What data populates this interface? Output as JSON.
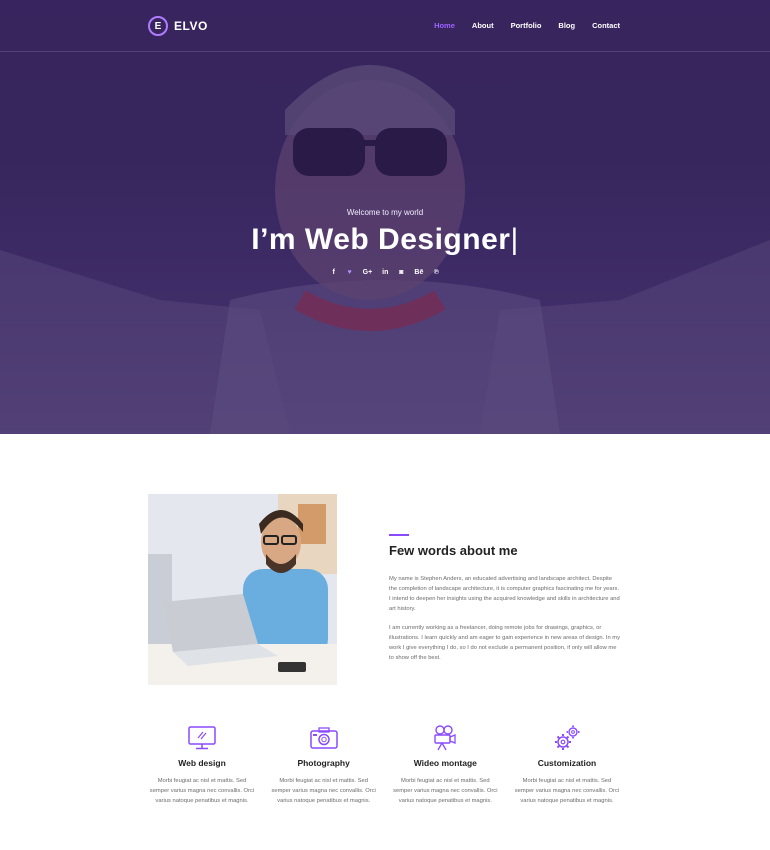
{
  "brand": {
    "logo_letter": "E",
    "name": "ELVO"
  },
  "nav": {
    "items": [
      {
        "label": "Home",
        "active": true
      },
      {
        "label": "About"
      },
      {
        "label": "Portfolio"
      },
      {
        "label": "Blog"
      },
      {
        "label": "Contact"
      }
    ]
  },
  "hero": {
    "welcome": "Welcome to my world",
    "headline": "I’m Web Designer",
    "cursor": "|",
    "socials": [
      {
        "glyph": "f",
        "icon": "facebook-icon"
      },
      {
        "glyph": "♥",
        "icon": "twitter-icon"
      },
      {
        "glyph": "G+",
        "icon": "google-plus-icon"
      },
      {
        "glyph": "in",
        "icon": "linkedin-icon"
      },
      {
        "glyph": "◙",
        "icon": "instagram-icon"
      },
      {
        "glyph": "Bē",
        "icon": "behance-icon"
      },
      {
        "glyph": "℗",
        "icon": "pinterest-icon"
      }
    ]
  },
  "about": {
    "title": "Few words about me",
    "paragraphs": [
      "My name is Stephen Anders, an educated advertising and landscape architect. Despite the completion of landscape architecture, it is computer graphics fascinating me for years. I intend to deepen her insights using the acquired knowledge and skills in architecture and art history.",
      "I am currently working as a freelancer, doing remote jobs for drawings, graphics, or illustrations. I learn quickly and am eager to gain experience in new areas of design. In my work I give everything I do, so I do not exclude a permanent position, if only will allow me to show off the best."
    ]
  },
  "services": [
    {
      "title": "Web design",
      "icon": "monitor-icon",
      "desc": "Morbi feugiat ac nisl et mattis. Sed semper varius magna nec convallis. Orci varius natoque penatibus et magnis."
    },
    {
      "title": "Photography",
      "icon": "camera-icon",
      "desc": "Morbi feugiat ac nisl et mattis. Sed semper varius magna nec convallis. Orci varius natoque penatibus et magnis."
    },
    {
      "title": "Wideo montage",
      "icon": "video-camera-icon",
      "desc": "Morbi feugiat ac nisl et mattis. Sed semper varius magna nec convallis. Orci varius natoque penatibus et magnis."
    },
    {
      "title": "Customization",
      "icon": "gears-icon",
      "desc": "Morbi feugiat ac nisl et mattis. Sed semper varius magna nec convallis. Orci varius natoque penatibus et magnis."
    }
  ],
  "colors": {
    "accent": "#8a4bff",
    "hero_overlay": "#3a2b5e",
    "nav_active": "#9d62ff"
  }
}
